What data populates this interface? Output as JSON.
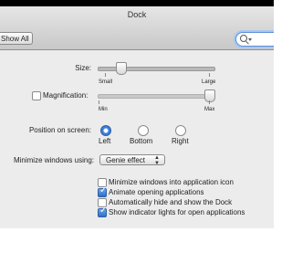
{
  "window": {
    "title": "Dock"
  },
  "toolbar": {
    "show_all_label": "Show All",
    "search": {
      "placeholder": "",
      "icon": "search-icon"
    }
  },
  "settings": {
    "size": {
      "label": "Size:",
      "min_label": "Small",
      "max_label": "Large",
      "value_fraction": 0.15
    },
    "magnification": {
      "label": "Magnification:",
      "enabled": false,
      "min_label": "Min",
      "max_label": "Max",
      "value_fraction": 0.95
    },
    "position": {
      "label": "Position on screen:",
      "options": [
        "Left",
        "Bottom",
        "Right"
      ],
      "selected": "Left"
    },
    "minimize": {
      "label": "Minimize windows using:",
      "selected": "Genie effect"
    },
    "checkboxes": [
      {
        "label": "Minimize windows into application icon",
        "checked": false
      },
      {
        "label": "Animate opening applications",
        "checked": true
      },
      {
        "label": "Automatically hide and show the Dock",
        "checked": false
      },
      {
        "label": "Show indicator lights for open applications",
        "checked": true
      }
    ]
  },
  "colors": {
    "accent": "#3d7fd9",
    "window_bg": "#ececec",
    "outer_bg": "#000000"
  }
}
